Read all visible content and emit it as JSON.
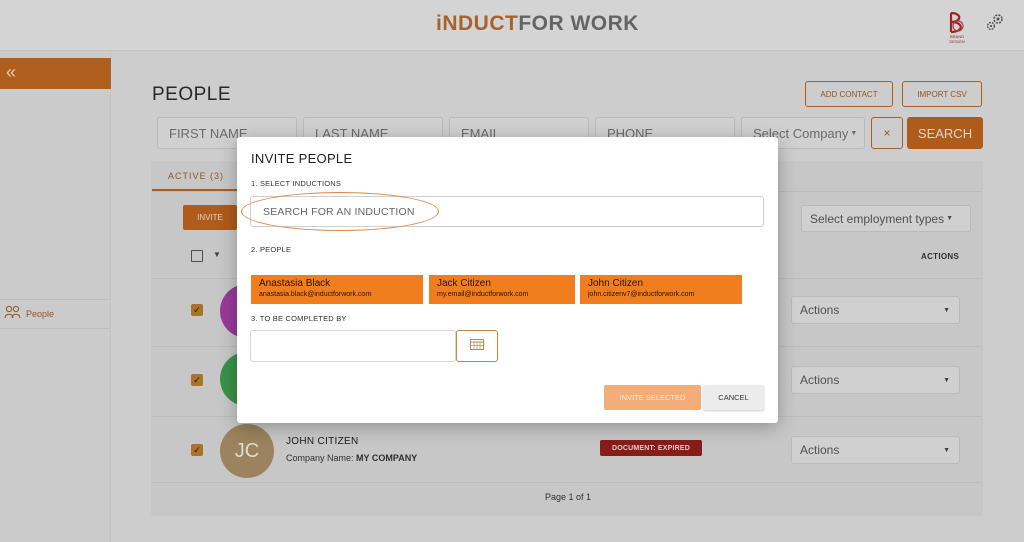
{
  "header": {
    "logo_part1": "iNDUCT",
    "logo_part2": "FOR WORK",
    "brand_caption": "BRAND DESIGN",
    "settings_icon": "gear-icon"
  },
  "sidebar": {
    "collapse_label": "«",
    "items": [
      {
        "label": "People",
        "icon": "people-icon"
      }
    ]
  },
  "main": {
    "title": "PEOPLE",
    "add_contact": "ADD CONTACT",
    "import_csv": "IMPORT CSV",
    "filters": {
      "first_name": "FIRST NAME",
      "last_name": "LAST NAME",
      "email": "EMAIL",
      "phone": "PHONE",
      "company": "Select Company"
    },
    "clear_label": "×",
    "search_label": "SEARCH",
    "tab_active": "ACTIVE (3)",
    "invite_label": "INVITE",
    "employment_select": "Select employment types",
    "actions_header": "ACTIONS",
    "rows": [
      {
        "initials": "",
        "name": "",
        "actions": "Actions",
        "avatar_color": "#a13ea3"
      },
      {
        "initials": "",
        "name": "",
        "actions": "Actions",
        "avatar_color": "#3f9a4d"
      },
      {
        "initials": "JC",
        "name": "JOHN CITIZEN",
        "company_label": "Company Name:",
        "company": "MY COMPANY",
        "status": "DOCUMENT: EXPIRED",
        "actions": "Actions",
        "avatar_color": "#a38b64"
      }
    ],
    "pager": "Page 1 of 1"
  },
  "modal": {
    "title": "INVITE PEOPLE",
    "section1": "1. SELECT INDUCTIONS",
    "search_placeholder": "SEARCH FOR AN INDUCTION",
    "section2": "2. PEOPLE",
    "people": [
      {
        "name": "Anastasia Black",
        "email": "anastasia.black@inductforwork.com"
      },
      {
        "name": "Jack Citizen",
        "email": "my.email@inductforwork.com"
      },
      {
        "name": "John Citizen",
        "email": "john.citizenv7@inductforwork.com"
      }
    ],
    "section3": "3. TO BE COMPLETED BY",
    "date_value": "",
    "invite_selected": "INVITE SELECTED",
    "cancel": "CANCEL"
  },
  "colors": {
    "accent": "#f07e1e",
    "accent_dark": "#b8601d",
    "expired": "#8f1f1a"
  }
}
